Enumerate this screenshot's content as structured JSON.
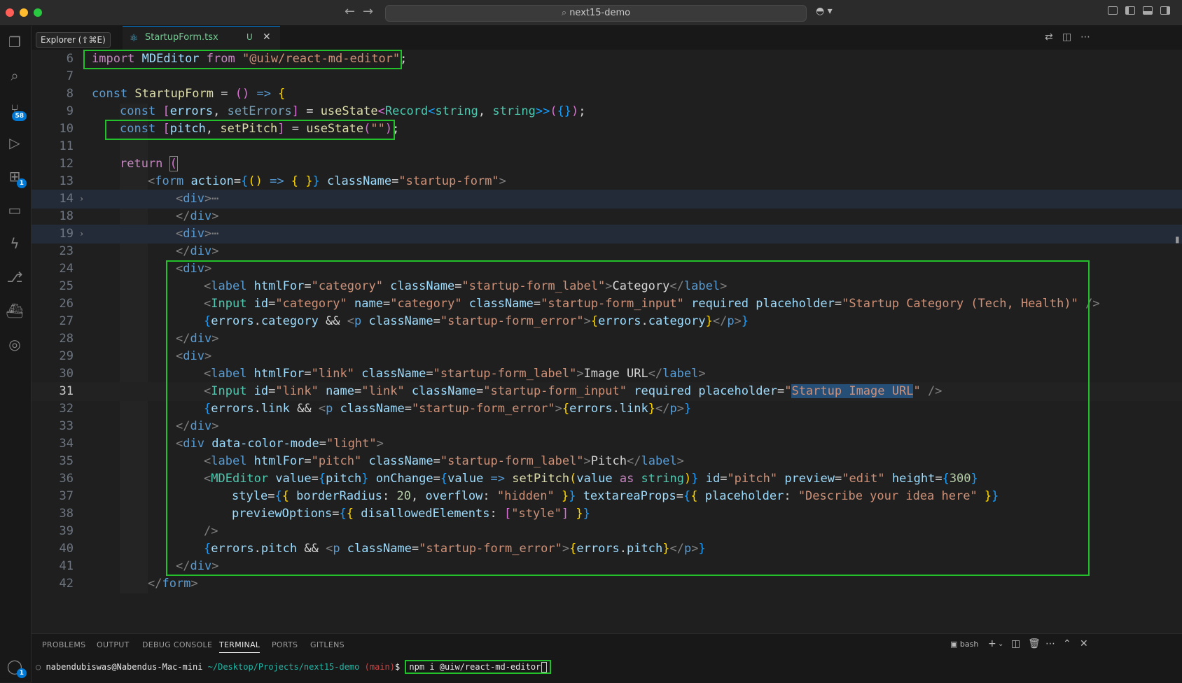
{
  "titlebar": {
    "search_text": "next15-demo"
  },
  "activity": {
    "scm_badge": "58",
    "extensions_badge": "1",
    "accounts_badge": "1"
  },
  "tabs": {
    "explorer_tooltip": "Explorer (⇧⌘E)",
    "active_file": "StartupForm.tsx",
    "active_status": "U"
  },
  "editor": {
    "lines": [
      {
        "num": "6"
      },
      {
        "num": "7"
      },
      {
        "num": "8"
      },
      {
        "num": "9"
      },
      {
        "num": "10"
      },
      {
        "num": "11"
      },
      {
        "num": "12"
      },
      {
        "num": "13"
      },
      {
        "num": "14"
      },
      {
        "num": "18"
      },
      {
        "num": "19"
      },
      {
        "num": "23"
      },
      {
        "num": "24"
      },
      {
        "num": "25"
      },
      {
        "num": "26"
      },
      {
        "num": "27"
      },
      {
        "num": "28"
      },
      {
        "num": "29"
      },
      {
        "num": "30"
      },
      {
        "num": "31"
      },
      {
        "num": "32"
      },
      {
        "num": "33"
      },
      {
        "num": "34"
      },
      {
        "num": "35"
      },
      {
        "num": "36"
      },
      {
        "num": "37"
      },
      {
        "num": "38"
      },
      {
        "num": "39"
      },
      {
        "num": "40"
      },
      {
        "num": "41"
      },
      {
        "num": "42"
      }
    ],
    "code": {
      "l6": {
        "t1": "import",
        "t2": " MDEditor ",
        "t3": "from",
        "t4": "\"@uiw/react-md-editor\"",
        "t5": ";"
      },
      "l8": {
        "t1": "const",
        "t2": " StartupForm",
        "t3": " = ",
        "t4": "()",
        "t5": " => ",
        "t6": "{"
      },
      "l9": {
        "t1": "const",
        "t2": " ",
        "t3": "[",
        "t4": "errors",
        "t5": ", ",
        "t6": "setErrors",
        "t7": "]",
        "t8": " = ",
        "t9": "useState",
        "t10": "<",
        "t11": "Record",
        "t12": "<",
        "t13": "string",
        "t14": ", ",
        "t15": "string",
        "t16": ">>",
        "t17": "(",
        "t18": "{}",
        "t19": ")",
        "t20": ";"
      },
      "l10": {
        "t1": "const",
        "t2": " ",
        "t3": "[",
        "t4": "pitch",
        "t5": ", ",
        "t6": "setPitch",
        "t7": "]",
        "t8": " = ",
        "t9": "useState",
        "t10": "(",
        "t11": "\"\"",
        "t12": ")",
        "t13": ";"
      },
      "l12": {
        "t1": "return",
        "t2": " ",
        "t3": "("
      },
      "l13": {
        "t1": "<",
        "t2": "form",
        "t3": " action",
        "t4": "=",
        "t5": "{",
        "t6": "()",
        "t7": " => ",
        "t8": "{ }",
        "t9": "}",
        "t10": " className",
        "t11": "=",
        "t12": "\"startup-form\"",
        "t13": ">"
      },
      "l14": {
        "t1": "<",
        "t2": "div",
        "t3": ">",
        "t4": "⋯"
      },
      "l18": {
        "t1": "</",
        "t2": "div",
        "t3": ">"
      },
      "l19": {
        "t1": "<",
        "t2": "div",
        "t3": ">",
        "t4": "⋯"
      },
      "l23": {
        "t1": "</",
        "t2": "div",
        "t3": ">"
      },
      "l24": {
        "t1": "<",
        "t2": "div",
        "t3": ">"
      },
      "l25": {
        "t1": "<",
        "t2": "label",
        "t3": " htmlFor",
        "t4": "=",
        "t5": "\"category\"",
        "t6": " className",
        "t7": "=",
        "t8": "\"startup-form_label\"",
        "t9": ">",
        "t10": "Category",
        "t11": "</",
        "t12": "label",
        "t13": ">"
      },
      "l26": {
        "t1": "<",
        "t2": "Input",
        "t3": " id",
        "t4": "=",
        "t5": "\"category\"",
        "t6": " name",
        "t7": "=",
        "t8": "\"category\"",
        "t9": " className",
        "t10": "=",
        "t11": "\"startup-form_input\"",
        "t12": " required",
        "t13": " placeholder",
        "t14": "=",
        "t15": "\"Startup Category (Tech, Health)\"",
        "t16": " />"
      },
      "l27": {
        "t1": "{",
        "t2": "errors",
        "t3": ".",
        "t4": "category",
        "t5": " && ",
        "t6": "<",
        "t7": "p",
        "t8": " className",
        "t9": "=",
        "t10": "\"startup-form_error\"",
        "t11": ">",
        "t12": "{",
        "t13": "errors",
        "t14": ".",
        "t15": "category",
        "t16": "}",
        "t17": "</",
        "t18": "p",
        "t19": ">",
        "t20": "}"
      },
      "l28": {
        "t1": "</",
        "t2": "div",
        "t3": ">"
      },
      "l29": {
        "t1": "<",
        "t2": "div",
        "t3": ">"
      },
      "l30": {
        "t1": "<",
        "t2": "label",
        "t3": " htmlFor",
        "t4": "=",
        "t5": "\"link\"",
        "t6": " className",
        "t7": "=",
        "t8": "\"startup-form_label\"",
        "t9": ">",
        "t10": "Image URL",
        "t11": "</",
        "t12": "label",
        "t13": ">"
      },
      "l31": {
        "t1": "<",
        "t2": "Input",
        "t3": " id",
        "t4": "=",
        "t5": "\"link\"",
        "t6": " name",
        "t7": "=",
        "t8": "\"link\"",
        "t9": " className",
        "t10": "=",
        "t11": "\"startup-form_input\"",
        "t12": " required",
        "t13": " placeholder",
        "t14": "=",
        "t15": "\"",
        "t16": "Startup Image URL",
        "t17": "\"",
        "t18": " />"
      },
      "l32": {
        "t1": "{",
        "t2": "errors",
        "t3": ".",
        "t4": "link",
        "t5": " && ",
        "t6": "<",
        "t7": "p",
        "t8": " className",
        "t9": "=",
        "t10": "\"startup-form_error\"",
        "t11": ">",
        "t12": "{",
        "t13": "errors",
        "t14": ".",
        "t15": "link",
        "t16": "}",
        "t17": "</",
        "t18": "p",
        "t19": ">",
        "t20": "}"
      },
      "l33": {
        "t1": "</",
        "t2": "div",
        "t3": ">"
      },
      "l34": {
        "t1": "<",
        "t2": "div",
        "t3": " data-color-mode",
        "t4": "=",
        "t5": "\"light\"",
        "t6": ">"
      },
      "l35": {
        "t1": "<",
        "t2": "label",
        "t3": " htmlFor",
        "t4": "=",
        "t5": "\"pitch\"",
        "t6": " className",
        "t7": "=",
        "t8": "\"startup-form_label\"",
        "t9": ">",
        "t10": "Pitch",
        "t11": "</",
        "t12": "label",
        "t13": ">"
      },
      "l36": {
        "t1": "<",
        "t2": "MDEditor",
        "t3": " value",
        "t4": "=",
        "t5": "{",
        "t6": "pitch",
        "t7": "}",
        "t8": " onChange",
        "t9": "=",
        "t10": "{",
        "t11": "value",
        "t12": " => ",
        "t13": "setPitch",
        "t14": "(",
        "t15": "value",
        "t16": " as ",
        "t17": "string",
        "t18": ")",
        "t19": "}",
        "t20": " id",
        "t21": "=",
        "t22": "\"pitch\"",
        "t23": " preview",
        "t24": "=",
        "t25": "\"edit\"",
        "t26": " height",
        "t27": "=",
        "t28": "{",
        "t29": "300",
        "t30": "}"
      },
      "l37": {
        "t1": "style",
        "t2": "=",
        "t3": "{",
        "t4": "{ ",
        "t5": "borderRadius",
        "t6": ": ",
        "t7": "20",
        "t8": ", ",
        "t9": "overflow",
        "t10": ": ",
        "t11": "\"hidden\"",
        "t12": " }",
        "t13": "}",
        "t14": " textareaProps",
        "t15": "=",
        "t16": "{",
        "t17": "{ ",
        "t18": "placeholder",
        "t19": ": ",
        "t20": "\"Describe your idea here\"",
        "t21": " }",
        "t22": "}"
      },
      "l38": {
        "t1": "previewOptions",
        "t2": "=",
        "t3": "{",
        "t4": "{ ",
        "t5": "disallowedElements",
        "t6": ": ",
        "t7": "[",
        "t8": "\"style\"",
        "t9": "]",
        "t10": " }",
        "t11": "}"
      },
      "l39": {
        "t1": "/>"
      },
      "l40": {
        "t1": "{",
        "t2": "errors",
        "t3": ".",
        "t4": "pitch",
        "t5": " && ",
        "t6": "<",
        "t7": "p",
        "t8": " className",
        "t9": "=",
        "t10": "\"startup-form_error\"",
        "t11": ">",
        "t12": "{",
        "t13": "errors",
        "t14": ".",
        "t15": "pitch",
        "t16": "}",
        "t17": "</",
        "t18": "p",
        "t19": ">",
        "t20": "}"
      },
      "l41": {
        "t1": "</",
        "t2": "div",
        "t3": ">"
      },
      "l42": {
        "t1": "</",
        "t2": "form",
        "t3": ">"
      }
    }
  },
  "panel": {
    "tabs": [
      "PROBLEMS",
      "OUTPUT",
      "DEBUG CONSOLE",
      "TERMINAL",
      "PORTS",
      "GITLENS"
    ],
    "shell": "bash",
    "terminal": {
      "user": "nabendubiswas@Nabendus-Mac-mini",
      "path": " ~/Desktop/Projects/next15-demo",
      "branch": " (main)",
      "dollar": "$ ",
      "command": "npm i @uiw/react-md-editor"
    }
  },
  "colors": {
    "highlight_box": "#22c02a",
    "accent": "#0078d4"
  }
}
